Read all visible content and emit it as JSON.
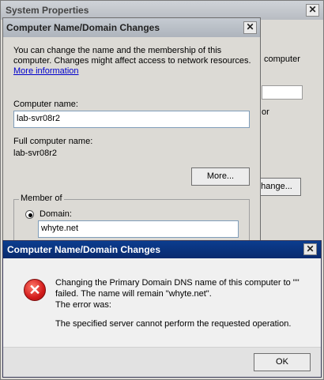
{
  "system_properties": {
    "title": "System Properties",
    "bg_label_right": "computer",
    "bg_label_or": "or",
    "change_button_partial": "hange..."
  },
  "name_dialog": {
    "title": "Computer Name/Domain Changes",
    "intro_line1": "You can change the name and the membership of this",
    "intro_line2": "computer. Changes might affect access to network resources.",
    "more_info_link": "More information",
    "computer_name_label": "Computer name:",
    "computer_name_value": "lab-svr08r2",
    "full_name_label": "Full computer name:",
    "full_name_value": "lab-svr08r2",
    "more_button": "More...",
    "member_of_label": "Member of",
    "domain_label": "Domain:",
    "domain_value": "whyte.net"
  },
  "error_dialog": {
    "title": "Computer Name/Domain Changes",
    "icon": "error-x-icon",
    "line1": "Changing the Primary Domain DNS name of this computer to \"\"",
    "line2": "failed. The name will remain \"whyte.net\".",
    "line3": "The error was:",
    "line4": "The specified server cannot perform the requested operation.",
    "ok_button": "OK"
  },
  "colors": {
    "error_titlebar": "#0a2a6e",
    "error_icon": "#d21b1b",
    "link": "#0000cc"
  }
}
